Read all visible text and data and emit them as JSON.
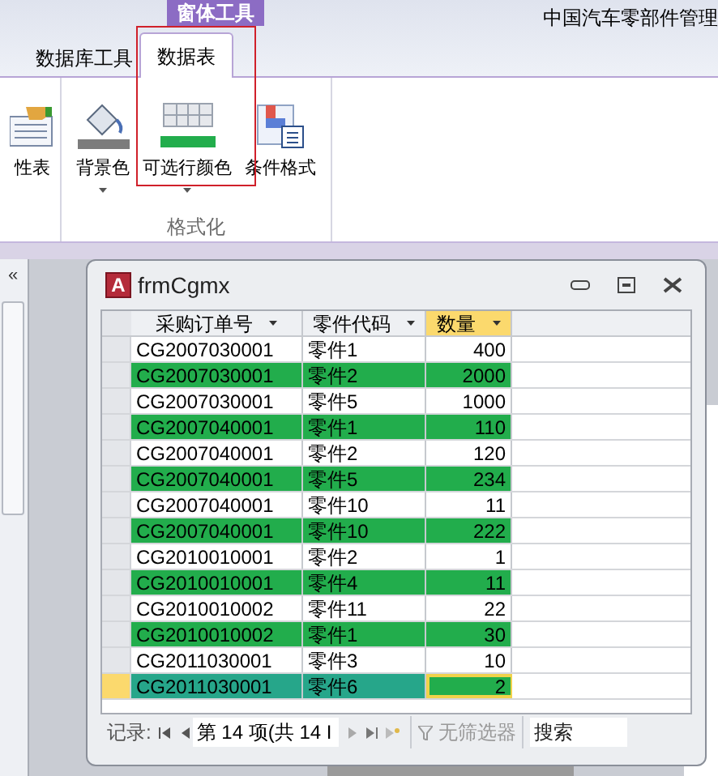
{
  "window": {
    "title": "中国汽车零部件管理"
  },
  "context_tab": "窗体工具",
  "tabs": [
    {
      "label": "数据库工具",
      "selected": false
    },
    {
      "label": "数据表",
      "selected": true
    }
  ],
  "ribbon": {
    "buttons": [
      {
        "label": "性表",
        "kind": "sheet",
        "dropdown": false
      },
      {
        "label": "背景色",
        "kind": "bucket",
        "dropdown": true
      },
      {
        "label": "可选行颜色",
        "kind": "altrows",
        "dropdown": true
      },
      {
        "label": "条件格式",
        "kind": "conditional",
        "dropdown": false
      }
    ],
    "group": "格式化"
  },
  "nav_pane": {
    "collapse": "«"
  },
  "form": {
    "icon_letter": "A",
    "title": "frmCgmx",
    "columns": [
      {
        "label": "采购订单号",
        "selected": false
      },
      {
        "label": "零件代码",
        "selected": false
      },
      {
        "label": "数量",
        "selected": true
      }
    ],
    "rows": [
      {
        "cells": [
          "CG2007030001",
          "零件1",
          "400"
        ],
        "alternate": false,
        "selected": false
      },
      {
        "cells": [
          "CG2007030001",
          "零件2",
          "2000"
        ],
        "alternate": true,
        "selected": false
      },
      {
        "cells": [
          "CG2007030001",
          "零件5",
          "1000"
        ],
        "alternate": false,
        "selected": false
      },
      {
        "cells": [
          "CG2007040001",
          "零件1",
          "110"
        ],
        "alternate": true,
        "selected": false
      },
      {
        "cells": [
          "CG2007040001",
          "零件2",
          "120"
        ],
        "alternate": false,
        "selected": false
      },
      {
        "cells": [
          "CG2007040001",
          "零件5",
          "234"
        ],
        "alternate": true,
        "selected": false
      },
      {
        "cells": [
          "CG2007040001",
          "零件10",
          "11"
        ],
        "alternate": false,
        "selected": false
      },
      {
        "cells": [
          "CG2007040001",
          "零件10",
          "222"
        ],
        "alternate": true,
        "selected": false
      },
      {
        "cells": [
          "CG2010010001",
          "零件2",
          "1"
        ],
        "alternate": false,
        "selected": false
      },
      {
        "cells": [
          "CG2010010001",
          "零件4",
          "11"
        ],
        "alternate": true,
        "selected": false
      },
      {
        "cells": [
          "CG2010010002",
          "零件11",
          "22"
        ],
        "alternate": false,
        "selected": false
      },
      {
        "cells": [
          "CG2010010002",
          "零件1",
          "30"
        ],
        "alternate": true,
        "selected": false
      },
      {
        "cells": [
          "CG2011030001",
          "零件3",
          "10"
        ],
        "alternate": false,
        "selected": false
      },
      {
        "cells": [
          "CG2011030001",
          "零件6",
          "2"
        ],
        "alternate": true,
        "selected": true
      }
    ],
    "navigation": {
      "label": "记录:",
      "position": "第 14 项(共 14 I",
      "filter": "无筛选器",
      "search_placeholder": "搜索"
    }
  }
}
